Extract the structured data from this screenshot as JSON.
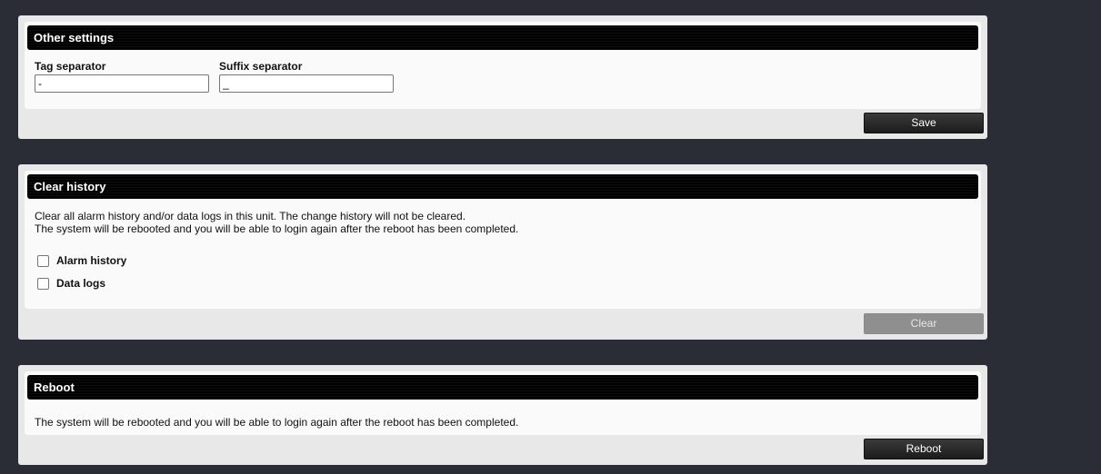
{
  "other_settings": {
    "title": "Other settings",
    "tag_separator_label": "Tag separator",
    "tag_separator_value": "-",
    "suffix_separator_label": "Suffix separator",
    "suffix_separator_value": "_",
    "save_label": "Save"
  },
  "clear_history": {
    "title": "Clear history",
    "description_line1": "Clear all alarm history and/or data logs in this unit. The change history will not be cleared.",
    "description_line2": "The system will be rebooted and you will be able to login again after the reboot has been completed.",
    "alarm_history_label": "Alarm history",
    "alarm_history_checked": false,
    "data_logs_label": "Data logs",
    "data_logs_checked": false,
    "clear_label": "Clear"
  },
  "reboot": {
    "title": "Reboot",
    "description": "The system will be rebooted and you will be able to login again after the reboot has been completed.",
    "reboot_label": "Reboot"
  }
}
